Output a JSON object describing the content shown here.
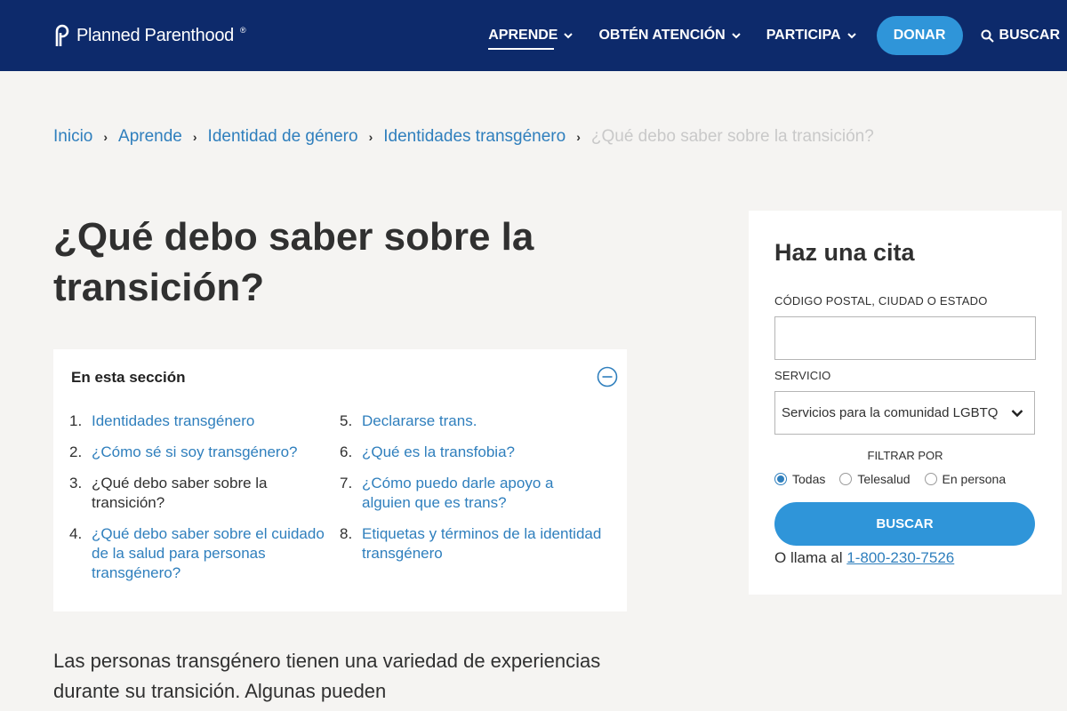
{
  "header": {
    "logo_text": "Planned Parenthood",
    "logo_mark": "®",
    "nav": [
      {
        "label": "APRENDE"
      },
      {
        "label": "OBTÉN ATENCIÓN"
      },
      {
        "label": "PARTICIPA"
      }
    ],
    "donate_label": "DONAR",
    "search_label": "BUSCAR"
  },
  "breadcrumb": [
    "Inicio",
    "Aprende",
    "Identidad de género",
    "Identidades transgénero",
    "¿Qué debo saber sobre la transición?"
  ],
  "page_title": "¿Qué debo saber sobre la transición?",
  "section": {
    "heading": "En esta sección",
    "items": [
      {
        "num": "1.",
        "label": "Identidades transgénero"
      },
      {
        "num": "2.",
        "label": "¿Cómo sé si soy transgénero?"
      },
      {
        "num": "3.",
        "label": "¿Qué debo saber sobre la transición?"
      },
      {
        "num": "4.",
        "label": "¿Qué debo saber sobre el cuidado de la salud para personas transgénero?"
      },
      {
        "num": "5.",
        "label": "Declararse trans."
      },
      {
        "num": "6.",
        "label": "¿Qué es la transfobia?"
      },
      {
        "num": "7.",
        "label": "¿Cómo puedo darle apoyo a alguien que es trans?"
      },
      {
        "num": "8.",
        "label": "Etiquetas y términos de la identidad transgénero"
      }
    ]
  },
  "body_text": "Las personas transgénero tienen una variedad de experiencias durante su transición. Algunas pueden",
  "appointment": {
    "title": "Haz una cita",
    "zip_label": "CÓDIGO POSTAL, CIUDAD O ESTADO",
    "zip_value": "",
    "service_label": "SERVICIO",
    "service_selected": "Servicios para la comunidad LGBTQ",
    "filter_label": "FILTRAR POR",
    "filters": [
      "Todas",
      "Telesalud",
      "En persona"
    ],
    "search_label": "BUSCAR",
    "call_prefix": "O llama al",
    "phone": "1-800-230-7526"
  },
  "colors": {
    "header_bg": "#0d2a6b",
    "accent": "#2f95d9",
    "link": "#2f7fbd"
  }
}
